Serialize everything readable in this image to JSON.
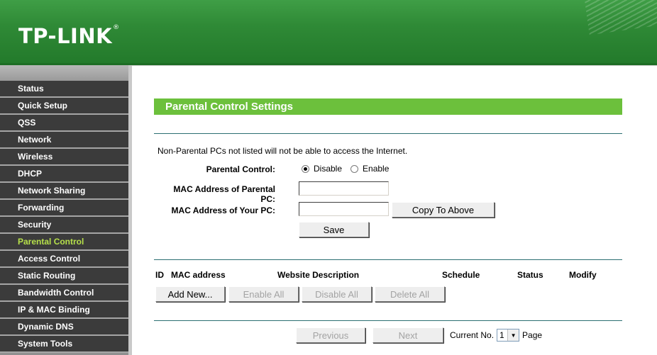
{
  "brand": {
    "logo_text": "TP-LINK",
    "logo_mark": "®"
  },
  "sidebar": {
    "items": [
      {
        "label": "Status"
      },
      {
        "label": "Quick Setup"
      },
      {
        "label": "QSS"
      },
      {
        "label": "Network"
      },
      {
        "label": "Wireless"
      },
      {
        "label": "DHCP"
      },
      {
        "label": "Network Sharing"
      },
      {
        "label": "Forwarding"
      },
      {
        "label": "Security"
      },
      {
        "label": "Parental Control",
        "active": true
      },
      {
        "label": "Access Control"
      },
      {
        "label": "Static Routing"
      },
      {
        "label": "Bandwidth Control"
      },
      {
        "label": "IP & MAC Binding"
      },
      {
        "label": "Dynamic DNS"
      },
      {
        "label": "System Tools"
      }
    ]
  },
  "main": {
    "title": "Parental Control Settings",
    "note": "Non-Parental PCs not listed will not be able to access the Internet.",
    "parental_control": {
      "label": "Parental Control:",
      "options": [
        "Disable",
        "Enable"
      ],
      "selected": "Disable"
    },
    "mac_parent": {
      "label": "MAC Address of Parental PC:",
      "value": ""
    },
    "mac_your": {
      "label": "MAC Address of Your PC:",
      "value": ""
    },
    "copy_button": "Copy To Above",
    "save_button": "Save",
    "table": {
      "columns": [
        "ID",
        "MAC address",
        "Website Description",
        "Schedule",
        "Status",
        "Modify"
      ]
    },
    "actions": {
      "add": "Add New...",
      "enable_all": "Enable All",
      "disable_all": "Disable All",
      "delete_all": "Delete All"
    },
    "pagination": {
      "previous": "Previous",
      "next": "Next",
      "current_label": "Current No.",
      "current_value": "1",
      "page_label": "Page"
    }
  },
  "colors": {
    "header_green": "#2f8a36",
    "title_bar": "#6cc03c",
    "sidebar_item": "#3b3b3b",
    "active_item": "#b6e04a"
  }
}
